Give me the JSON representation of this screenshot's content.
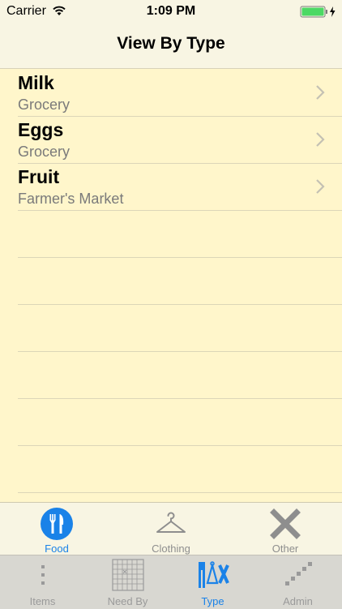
{
  "status_bar": {
    "carrier": "Carrier",
    "time": "1:09 PM",
    "battery_color": "#4cd964"
  },
  "nav": {
    "title": "View By Type"
  },
  "list": {
    "items": [
      {
        "title": "Milk",
        "subtitle": "Grocery"
      },
      {
        "title": "Eggs",
        "subtitle": "Grocery"
      },
      {
        "title": "Fruit",
        "subtitle": "Farmer's Market"
      }
    ]
  },
  "type_tabs": {
    "selected": "Food",
    "items": [
      {
        "label": "Food",
        "icon": "fork-knife-icon"
      },
      {
        "label": "Clothing",
        "icon": "hanger-icon"
      },
      {
        "label": "Other",
        "icon": "x-icon"
      }
    ]
  },
  "main_tabs": {
    "selected": "Type",
    "items": [
      {
        "label": "Items",
        "icon": "vertical-dots-icon"
      },
      {
        "label": "Need By",
        "icon": "calendar-grid-icon"
      },
      {
        "label": "Type",
        "icon": "type-symbols-icon"
      },
      {
        "label": "Admin",
        "icon": "admin-steps-icon"
      }
    ]
  },
  "colors": {
    "accent": "#1a82e8",
    "background": "#fff6cb",
    "bar_background": "#f8f5e3",
    "inactive": "#8e8e8e"
  }
}
